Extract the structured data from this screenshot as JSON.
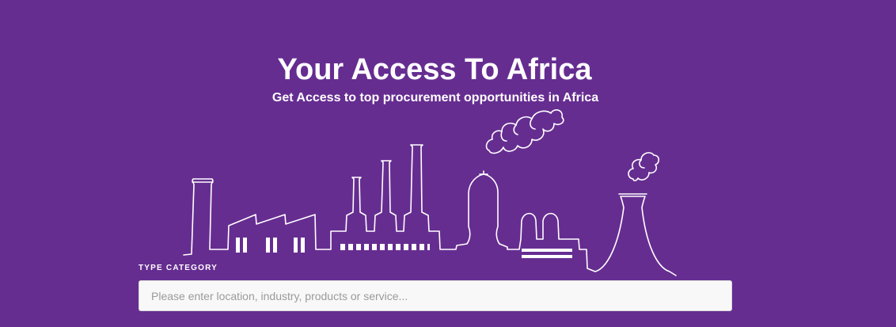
{
  "hero": {
    "title": "Your Access To Africa",
    "subtitle": "Get Access to top procurement opportunities in Africa",
    "background_color": "#662d91",
    "illustration_icon": "industrial-skyline-icon"
  },
  "search": {
    "label": "TYPE CATEGORY",
    "placeholder": "Please enter location, industry, products or service...",
    "value": ""
  }
}
